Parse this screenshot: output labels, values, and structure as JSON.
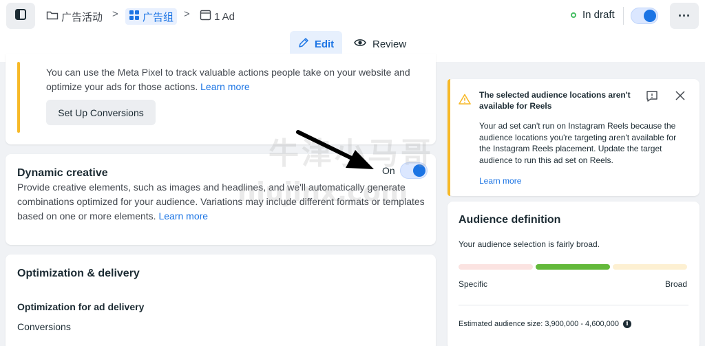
{
  "header": {
    "breadcrumbs": [
      {
        "label": "广告活动",
        "icon": "folder-icon"
      },
      {
        "label": "广告组",
        "icon": "grid-icon"
      },
      {
        "label": "1 Ad",
        "icon": "ad-icon"
      }
    ],
    "status_label": "In draft",
    "status_color": "#45bd62",
    "publish_toggle_on": true,
    "more_label": "···"
  },
  "tabs": {
    "edit_label": "Edit",
    "review_label": "Review"
  },
  "conversions": {
    "text": "You can use the Meta Pixel to track valuable actions people take on your website and optimize your ads for those actions.",
    "learn_more": "Learn more",
    "setup_button": "Set Up Conversions"
  },
  "dynamic_creative": {
    "title": "Dynamic creative",
    "toggle_label": "On",
    "toggle_on": true,
    "description": "Provide creative elements, such as images and headlines, and we'll automatically generate combinations optimized for your audience. Variations may include different formats or templates based on one or more elements.",
    "learn_more": "Learn more"
  },
  "optimization": {
    "title": "Optimization & delivery",
    "sub_label": "Optimization for ad delivery",
    "value": "Conversions"
  },
  "warning": {
    "title": "The selected audience locations aren't available for Reels",
    "body": "Your ad set can't run on Instagram Reels because the audience locations you're targeting aren't available for the Instagram Reels placement. Update the target audience to run this ad set on Reels.",
    "link": "Learn more"
  },
  "audience": {
    "title": "Audience definition",
    "summary": "Your audience selection is fairly broad.",
    "meter_position": "middle",
    "specific_label": "Specific",
    "broad_label": "Broad",
    "estimated_size": "Estimated audience size: 3,900,000 - 4,600,000",
    "info_icon": "i"
  },
  "watermark": {
    "line1": "牛津小马哥",
    "line2": "niujinx.com"
  },
  "colors": {
    "accent": "#1b74e4",
    "warning": "#f7b928",
    "meter_left": "#fbe3e1",
    "meter_middle": "#63b93b",
    "meter_right": "#fdf0d2"
  }
}
